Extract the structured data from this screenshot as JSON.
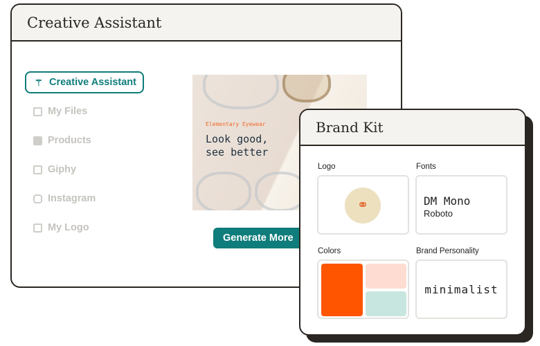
{
  "main_window": {
    "title": "Creative Assistant",
    "nav": [
      {
        "label": "Creative Assistant",
        "icon": "magic-wand-icon",
        "active": true
      },
      {
        "label": "My Files",
        "icon": "images-icon"
      },
      {
        "label": "Products",
        "icon": "tshirt-icon"
      },
      {
        "label": "Giphy",
        "icon": "file-icon"
      },
      {
        "label": "Instagram",
        "icon": "instagram-icon"
      },
      {
        "label": "My Logo",
        "icon": "image-icon"
      }
    ],
    "ad": {
      "brand": "Elementary Eyewear",
      "headline": "Look good,\nsee better"
    },
    "generate_label": "Generate More"
  },
  "brand_kit": {
    "title": "Brand Kit",
    "logo_label": "Logo",
    "fonts_label": "Fonts",
    "font_primary": "DM Mono",
    "font_secondary": "Roboto",
    "colors_label": "Colors",
    "personality_label": "Brand Personality",
    "personality": "minimalist",
    "colors": [
      "#ff5500",
      "#ffdcd2",
      "#c8e6e0"
    ]
  },
  "accent": "#0f7d7b"
}
